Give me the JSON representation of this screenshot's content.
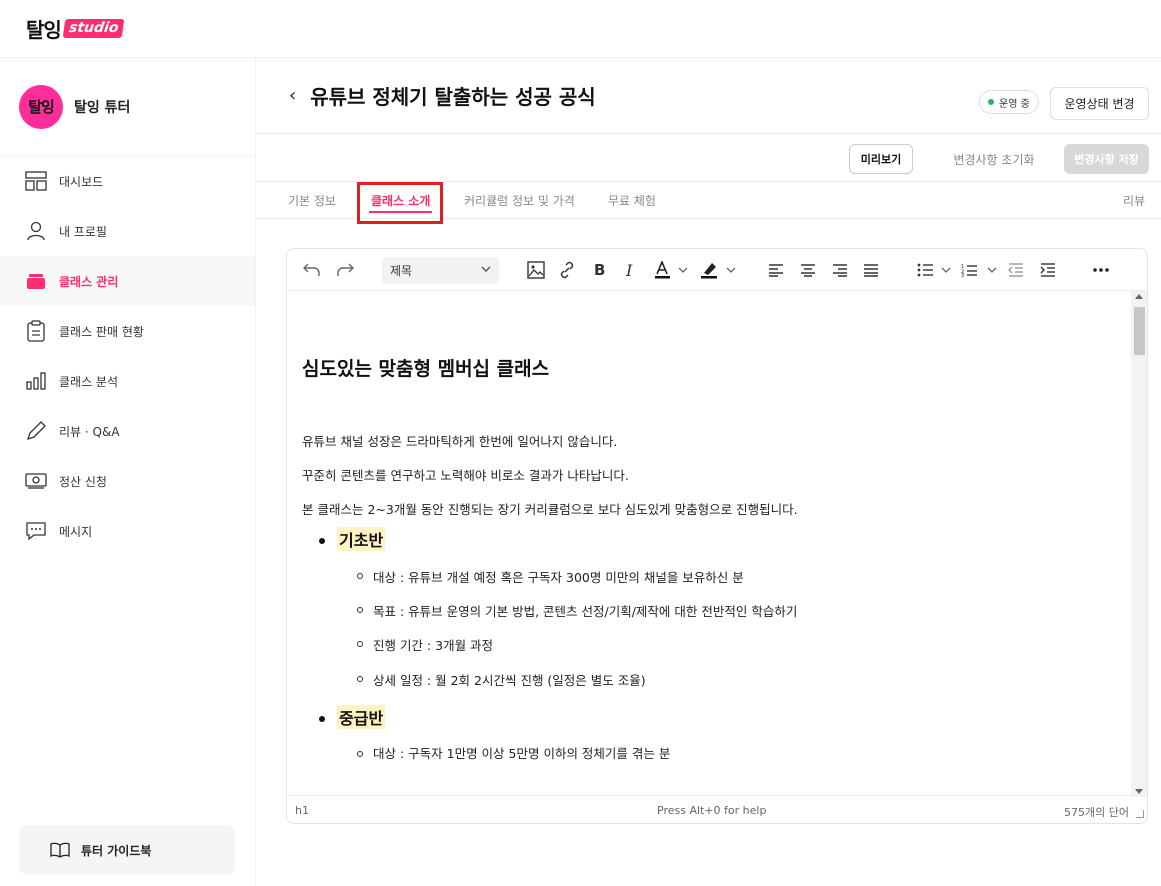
{
  "brand": {
    "logo_main": "탈잉",
    "logo_studio": "studio",
    "accent": "#ff2d6f"
  },
  "sidebar": {
    "avatar_text": "탈잉",
    "profile_name": "탈잉 튜터",
    "items": [
      {
        "label": "대시보드",
        "icon": "dashboard-icon"
      },
      {
        "label": "내 프로필",
        "icon": "user-icon"
      },
      {
        "label": "클래스 관리",
        "icon": "folder-icon",
        "active": true
      },
      {
        "label": "클래스 판매 현황",
        "icon": "clipboard-icon"
      },
      {
        "label": "클래스 분석",
        "icon": "bar-chart-icon"
      },
      {
        "label": "리뷰 · Q&A",
        "icon": "pencil-icon"
      },
      {
        "label": "정산 신청",
        "icon": "money-icon"
      },
      {
        "label": "메시지",
        "icon": "chat-icon"
      }
    ],
    "guide_label": "튜터 가이드북"
  },
  "header": {
    "back": "‹",
    "title": "유튜브 정체기 탈출하는 성공 공식",
    "status": "운영 중",
    "status_change": "운영상태 변경"
  },
  "actions": {
    "preview": "미리보기",
    "reset": "변경사항 초기화",
    "save": "변경사항 저장"
  },
  "tabs": [
    {
      "label": "기본 정보"
    },
    {
      "label": "클래스 소개",
      "active": true
    },
    {
      "label": "커리큘럼 정보 및 가격"
    },
    {
      "label": "무료 체험"
    },
    {
      "label": "리뷰"
    }
  ],
  "editor": {
    "format_select": "제목",
    "content": {
      "heading": "심도있는 맞춤형 멤버십 클래스",
      "paragraphs": [
        "유튜브 채널 성장은 드라마틱하게 한번에 일어나지 않습니다.",
        "꾸준히 콘텐츠를 연구하고 노력해야 비로소 결과가 나타납니다.",
        "본 클래스는 2~3개월 동안 진행되는 장기 커리큘럼으로 보다 심도있게 맞춤형으로 진행됩니다."
      ],
      "sections": [
        {
          "title": "기초반",
          "items": [
            "대상 : 유튜브 개설 예정 혹은 구독자 300명 미만의 채널을 보유하신 분",
            "목표 : 유튜브 운영의 기본 방법, 콘텐츠 선정/기획/제작에 대한 전반적인 학습하기",
            "진행 기간 : 3개월 과정",
            "상세 일정 : 월 2회 2시간씩 진행 (일정은 별도 조율)"
          ]
        },
        {
          "title": "중급반",
          "items": [
            "대상 : 구독자 1만명 이상 5만명 이하의 정체기를 겪는 분"
          ]
        }
      ]
    },
    "status": {
      "element": "h1",
      "help": "Press Alt+0 for help",
      "word_count": "575개의 단어"
    }
  }
}
